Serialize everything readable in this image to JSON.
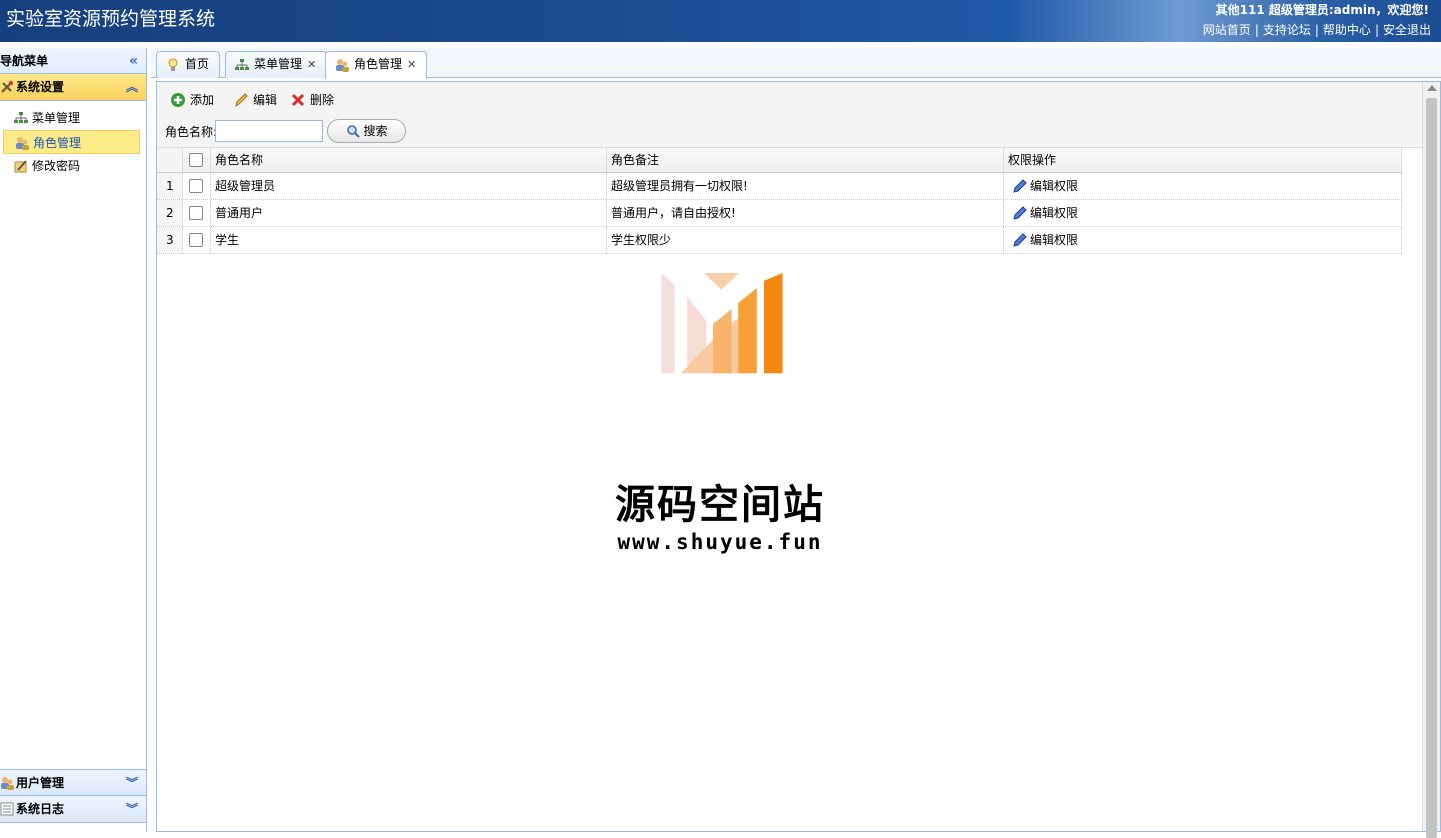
{
  "header": {
    "title": "实验室资源预约管理系统",
    "welcome": "其他111 超级管理员:admin，欢迎您!",
    "links": [
      "网站首页",
      "支持论坛",
      "帮助中心",
      "安全退出"
    ]
  },
  "sidebar": {
    "title": "导航菜单",
    "sections": [
      {
        "label": "系统设置",
        "items": [
          "菜单管理",
          "角色管理",
          "修改密码"
        ]
      },
      {
        "label": "用户管理"
      },
      {
        "label": "系统日志"
      }
    ]
  },
  "tabs": [
    {
      "label": "首页"
    },
    {
      "label": "菜单管理"
    },
    {
      "label": "角色管理"
    }
  ],
  "toolbar": {
    "add": "添加",
    "edit": "编辑",
    "delete": "删除",
    "search_label": "角色名称:",
    "search_value": "",
    "search_button": "搜索"
  },
  "table": {
    "columns": [
      "角色名称",
      "角色备注",
      "权限操作"
    ],
    "rows": [
      {
        "num": "1",
        "name": "超级管理员",
        "note": "超级管理员拥有一切权限!",
        "op": "编辑权限"
      },
      {
        "num": "2",
        "name": "普通用户",
        "note": "普通用户，请自由授权!",
        "op": "编辑权限"
      },
      {
        "num": "3",
        "name": "学生",
        "note": "学生权限少",
        "op": "编辑权限"
      }
    ]
  },
  "watermark": {
    "name": "源码空间站",
    "url": "www.shuyue.fun"
  },
  "colors": {
    "header_dark": "#163f7d",
    "accent_orange": "#f5870f",
    "selected_yellow": "#fbec88",
    "border_blue": "#99bbe8"
  }
}
